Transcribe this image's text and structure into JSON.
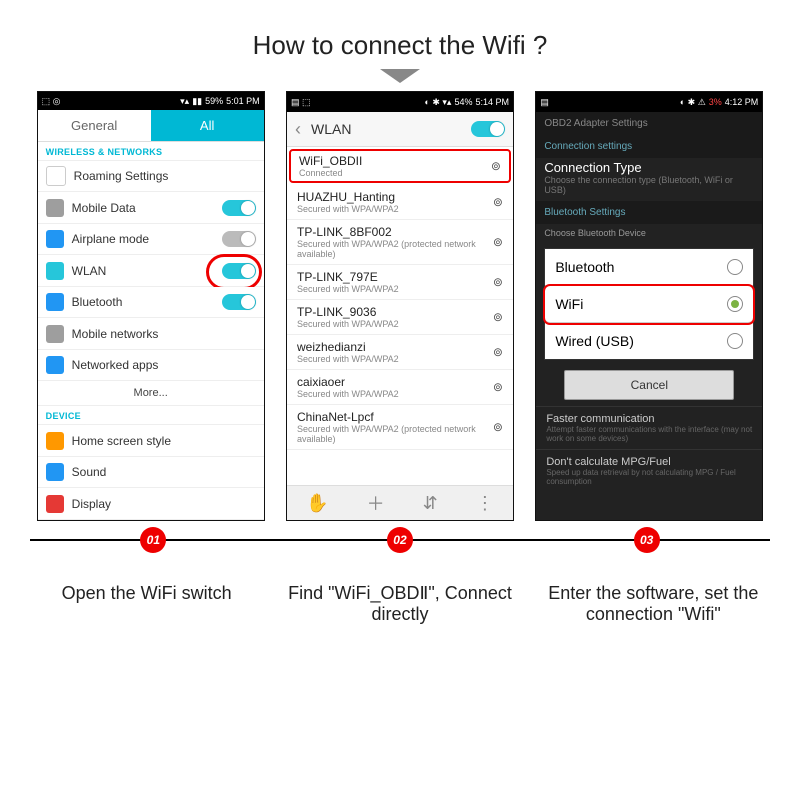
{
  "title": "How to connect the Wifi ?",
  "steps": [
    "01",
    "02",
    "03"
  ],
  "captions": [
    "Open the WiFi switch",
    "Find \"WiFi_OBDⅡ\", Connect directly",
    "Enter the software, set the connection \"Wifi\""
  ],
  "p1": {
    "status": {
      "left": "",
      "battery": "59%",
      "time": "5:01 PM"
    },
    "tabs": [
      "General",
      "All"
    ],
    "sections": [
      {
        "title": "WIRELESS & NETWORKS",
        "rows": [
          {
            "icon": "roaming",
            "label": "Roaming Settings",
            "toggle": null
          },
          {
            "icon": "mobile-data",
            "label": "Mobile Data",
            "toggle": "on"
          },
          {
            "icon": "airplane",
            "label": "Airplane mode",
            "toggle": "off"
          },
          {
            "icon": "wlan",
            "label": "WLAN",
            "toggle": "on",
            "highlight": true
          },
          {
            "icon": "bluetooth",
            "label": "Bluetooth",
            "toggle": "on"
          },
          {
            "icon": "mobile-net",
            "label": "Mobile networks",
            "toggle": null
          },
          {
            "icon": "net-apps",
            "label": "Networked apps",
            "toggle": null
          }
        ],
        "more": "More..."
      },
      {
        "title": "DEVICE",
        "rows": [
          {
            "icon": "home",
            "label": "Home screen style"
          },
          {
            "icon": "sound",
            "label": "Sound"
          },
          {
            "icon": "display",
            "label": "Display"
          }
        ]
      }
    ]
  },
  "p2": {
    "status": {
      "battery": "54%",
      "time": "5:14 PM"
    },
    "header": "WLAN",
    "nets": [
      {
        "name": "WiFi_OBDII",
        "sub": "Connected",
        "hl": true
      },
      {
        "name": "HUAZHU_Hanting",
        "sub": "Secured with WPA/WPA2"
      },
      {
        "name": "TP-LINK_8BF002",
        "sub": "Secured with WPA/WPA2 (protected network available)"
      },
      {
        "name": "TP-LINK_797E",
        "sub": "Secured with WPA/WPA2"
      },
      {
        "name": "TP-LINK_9036",
        "sub": "Secured with WPA/WPA2"
      },
      {
        "name": "weizhedianzi",
        "sub": "Secured with WPA/WPA2"
      },
      {
        "name": "caixiaoer",
        "sub": "Secured with WPA/WPA2"
      },
      {
        "name": "ChinaNet-Lpcf",
        "sub": "Secured with WPA/WPA2 (protected network available)"
      }
    ]
  },
  "p3": {
    "status": {
      "battery": "3%",
      "time": "4:12 PM"
    },
    "header": "OBD2 Adapter Settings",
    "sub": "Connection settings",
    "ct_title": "Connection Type",
    "ct_desc": "Choose the connection type (Bluetooth, WiFi or USB)",
    "bt_title": "Bluetooth Settings",
    "bt_sub": "Choose Bluetooth Device",
    "options": [
      {
        "label": "Bluetooth",
        "sel": false
      },
      {
        "label": "WiFi",
        "sel": true,
        "hl": true
      },
      {
        "label": "Wired (USB)",
        "sel": false
      }
    ],
    "cancel": "Cancel",
    "extra": [
      {
        "t": "Faster communication",
        "d": "Attempt faster communications with the interface (may not work on some devices)"
      },
      {
        "t": "Don't calculate MPG/Fuel",
        "d": "Speed up data retrieval by not calculating MPG / Fuel consumption"
      }
    ]
  }
}
